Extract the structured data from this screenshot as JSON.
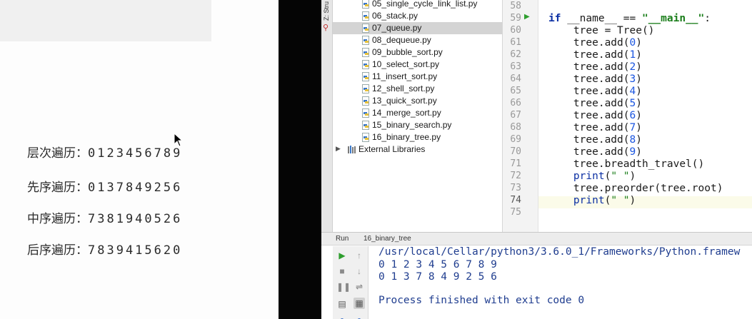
{
  "slide": {
    "rows": [
      {
        "label": "层次遍历：",
        "sequence": "0123456789"
      },
      {
        "label": "先序遍历：",
        "sequence": "0137849256"
      },
      {
        "label": "中序遍历：",
        "sequence": "7381940526"
      },
      {
        "label": "后序遍历：",
        "sequence": "7839415620"
      }
    ]
  },
  "ide": {
    "structure_tab": "Z: Stru",
    "project": {
      "files": [
        "05_single_cycle_link_list.py",
        "06_stack.py",
        "07_queue.py",
        "08_dequeue.py",
        "09_bubble_sort.py",
        "10_select_sort.py",
        "11_insert_sort.py",
        "12_shell_sort.py",
        "13_quick_sort.py",
        "14_merge_sort.py",
        "15_binary_search.py",
        "16_binary_tree.py"
      ],
      "selected_file": "07_queue.py",
      "external_libraries": "External Libraries"
    },
    "editor": {
      "line_numbers": [
        "58",
        "59",
        "60",
        "61",
        "62",
        "63",
        "64",
        "65",
        "66",
        "67",
        "68",
        "69",
        "70",
        "71",
        "72",
        "73",
        "74",
        "75"
      ],
      "current_line": "74"
    },
    "run": {
      "header_label": "Run",
      "config_name": "16_binary_tree",
      "output": [
        "/usr/local/Cellar/python3/3.6.0_1/Frameworks/Python.framew",
        "0 1 2 3 4 5 6 7 8 9",
        "0 1 3 7 8 4 9 2 5 6",
        "",
        "Process finished with exit code 0"
      ]
    }
  }
}
